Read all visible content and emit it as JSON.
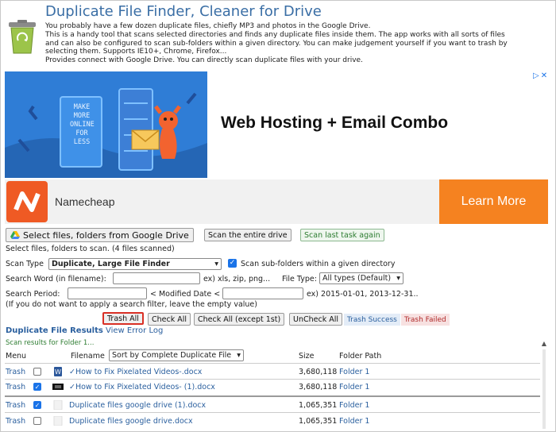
{
  "header": {
    "title": "Duplicate File Finder, Cleaner for Drive",
    "description_lines": [
      "You probably have a few dozen duplicate files, chiefly MP3 and photos in the Google Drive.",
      "This is a handy tool that scans selected directories and finds any duplicate files inside them. The app works with all sorts of files",
      "and can also be configured to scan sub-folders within a given directory. You can make judgement yourself if you want to trash by",
      "selecting them. Supports IE10+, Chrome, Firefox...",
      "Provides connect with Google Drive. You can directly scan duplicate files with your drive."
    ]
  },
  "ad": {
    "headline": "Web Hosting + Email Combo",
    "illustration_text": [
      "MAKE",
      "MORE",
      "ONLINE",
      "FOR",
      "LESS"
    ],
    "advertiser": "Namecheap",
    "cta": "Learn More",
    "brand_color": "#ef5a24",
    "cta_color": "#f58220"
  },
  "actions": {
    "select_files": "Select files, folders from Google Drive",
    "scan_entire": "Scan the entire drive",
    "scan_last": "Scan last task again",
    "selection_hint": "Select files, folders to scan. (4 files scanned)"
  },
  "options": {
    "scan_type_label": "Scan Type",
    "scan_type_value": "Duplicate, Large File Finder",
    "scan_subfolders_label": "Scan sub-folders within a given directory",
    "scan_subfolders_checked": true,
    "search_word_label": "Search Word (in filename):",
    "search_word_value": "",
    "search_word_hint": "ex) xls, zip, png...",
    "file_type_label": "File Type:",
    "file_type_value": "All types (Default)",
    "search_period_label": "Search Period:",
    "modified_date_label": "< Modified Date <",
    "search_period_hint": "ex) 2015-01-01, 2013-12-31..",
    "filter_note": "(If you do not want to apply a search filter, leave the empty value)"
  },
  "toolbar": {
    "trash_all": "Trash All",
    "check_all": "Check All",
    "check_all_except": "Check All (except 1st)",
    "uncheck_all": "UnCheck All",
    "trash_success": "Trash Success",
    "trash_failed": "Trash Failed"
  },
  "results": {
    "title": "Duplicate File Results",
    "error_log": "View Error Log",
    "scan_note": "Scan results for Folder 1...",
    "columns": {
      "menu": "Menu",
      "filename": "Filename",
      "sort": "Sort by Complete Duplicate File",
      "size": "Size",
      "folder": "Folder Path"
    },
    "rows": [
      {
        "menu": "Trash",
        "checked": false,
        "icon": "word-doc-icon",
        "name": "✓How to Fix Pixelated Videos-.docx",
        "size": "3,680,118",
        "folder": "Folder 1"
      },
      {
        "menu": "Trash",
        "checked": true,
        "icon": "thumbnail-icon",
        "name": "✓How to Fix Pixelated Videos- (1).docx",
        "size": "3,680,118",
        "folder": "Folder 1"
      },
      {
        "menu": "Trash",
        "checked": true,
        "icon": "blank-doc-icon",
        "name": "Duplicate files google drive (1).docx",
        "size": "1,065,351",
        "folder": "Folder 1"
      },
      {
        "menu": "Trash",
        "checked": false,
        "icon": "blank-doc-icon",
        "name": "Duplicate files google drive.docx",
        "size": "1,065,351",
        "folder": "Folder 1"
      }
    ]
  }
}
